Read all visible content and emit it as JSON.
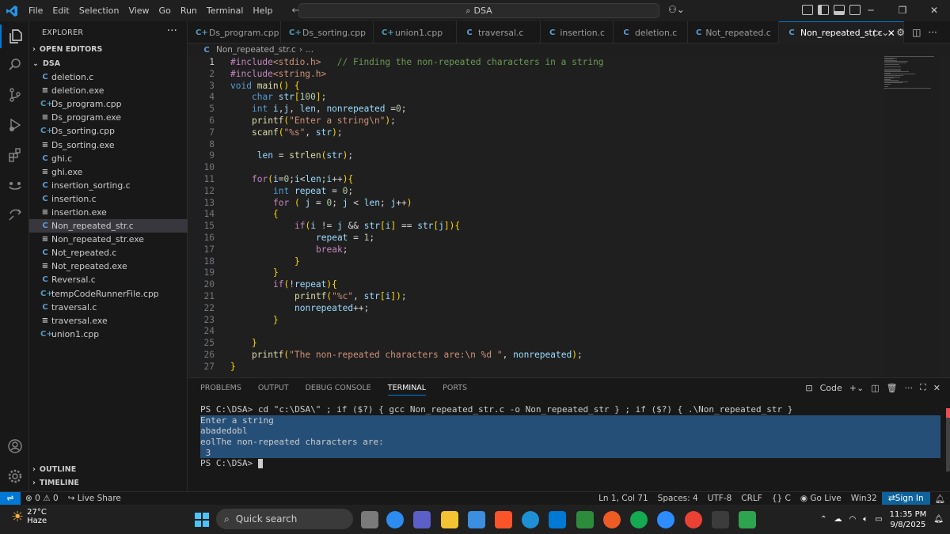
{
  "titlebar": {
    "menu": [
      "File",
      "Edit",
      "Selection",
      "View",
      "Go",
      "Run",
      "Terminal",
      "Help"
    ],
    "search": "DSA"
  },
  "explorer": {
    "title": "EXPLORER",
    "open_editors": "OPEN EDITORS",
    "folder": "DSA",
    "files": [
      {
        "name": "deletion.c",
        "type": "c"
      },
      {
        "name": "deletion.exe",
        "type": "exe"
      },
      {
        "name": "Ds_program.cpp",
        "type": "cpp"
      },
      {
        "name": "Ds_program.exe",
        "type": "exe"
      },
      {
        "name": "Ds_sorting.cpp",
        "type": "cpp"
      },
      {
        "name": "Ds_sorting.exe",
        "type": "exe"
      },
      {
        "name": "ghi.c",
        "type": "c"
      },
      {
        "name": "ghi.exe",
        "type": "exe"
      },
      {
        "name": "insertion_sorting.c",
        "type": "c"
      },
      {
        "name": "insertion.c",
        "type": "c"
      },
      {
        "name": "insertion.exe",
        "type": "exe"
      },
      {
        "name": "Non_repeated_str.c",
        "type": "c",
        "selected": true
      },
      {
        "name": "Non_repeated_str.exe",
        "type": "exe"
      },
      {
        "name": "Not_repeated.c",
        "type": "c"
      },
      {
        "name": "Not_repeated.exe",
        "type": "exe"
      },
      {
        "name": "Reversal.c",
        "type": "c"
      },
      {
        "name": "tempCodeRunnerFile.cpp",
        "type": "cpp"
      },
      {
        "name": "traversal.c",
        "type": "c"
      },
      {
        "name": "traversal.exe",
        "type": "exe"
      },
      {
        "name": "union1.cpp",
        "type": "cpp"
      }
    ],
    "outline": "OUTLINE",
    "timeline": "TIMELINE"
  },
  "tabs": [
    {
      "name": "Ds_program.cpp",
      "type": "cpp"
    },
    {
      "name": "Ds_sorting.cpp",
      "type": "cpp"
    },
    {
      "name": "union1.cpp",
      "type": "cpp"
    },
    {
      "name": "traversal.c",
      "type": "c"
    },
    {
      "name": "insertion.c",
      "type": "c"
    },
    {
      "name": "deletion.c",
      "type": "c"
    },
    {
      "name": "Not_repeated.c",
      "type": "c"
    },
    {
      "name": "Non_repeated_str.c",
      "type": "c",
      "active": true
    }
  ],
  "breadcrumb": {
    "file": "Non_repeated_str.c",
    "more": "..."
  },
  "editor": {
    "current_line": 1,
    "lines": [
      "#include<stdio.h>   // Finding the non-repeated characters in a string",
      "#include<string.h>",
      "void main() {",
      "    char str[100];",
      "    int i,j, len, nonrepeated =0;",
      "    printf(\"Enter a string\\n\");",
      "    scanf(\"%s\", str);",
      "",
      "     len = strlen(str);",
      "",
      "    for(i=0;i<len;i++){",
      "        int repeat = 0;",
      "        for ( j = 0; j < len; j++)",
      "        {",
      "            if(i != j && str[i] == str[j]){",
      "                repeat = 1;",
      "                break;",
      "            }",
      "        }",
      "        if(!repeat){",
      "            printf(\"%c\", str[i]);",
      "            nonrepeated++;",
      "        }",
      "",
      "    }",
      "    printf(\"The non-repeated characters are:\\n %d \", nonrepeated);",
      "}"
    ]
  },
  "panel": {
    "tabs": [
      "PROBLEMS",
      "OUTPUT",
      "DEBUG CONSOLE",
      "TERMINAL",
      "PORTS"
    ],
    "active_tab": "TERMINAL",
    "terminal_profile": "Code",
    "terminal_lines": [
      {
        "text": "PS C:\\DSA> cd \"c:\\DSA\\\" ; if ($?) { gcc Non_repeated_str.c -o Non_repeated_str } ; if ($?) { .\\Non_repeated_str }",
        "selected": false
      },
      {
        "text": "Enter a string",
        "selected": true
      },
      {
        "text": "abadedobl",
        "selected": true
      },
      {
        "text": "eolThe non-repeated characters are:",
        "selected": true
      },
      {
        "text": " 3",
        "selected": true
      },
      {
        "text": "PS C:\\DSA> ",
        "selected": false,
        "cursor": true
      }
    ]
  },
  "statusbar": {
    "errors": "0",
    "warnings": "0",
    "live_share": "Live Share",
    "position": "Ln 1, Col 71",
    "spaces": "Spaces: 4",
    "encoding": "UTF-8",
    "eol": "CRLF",
    "language": "C",
    "go_live": "Go Live",
    "platform": "Win32",
    "sign_in": "Sign In"
  },
  "taskbar": {
    "temperature": "27°C",
    "weather": "Haze",
    "search_placeholder": "Quick search",
    "time": "11:35 PM",
    "date": "9/8/2025"
  }
}
